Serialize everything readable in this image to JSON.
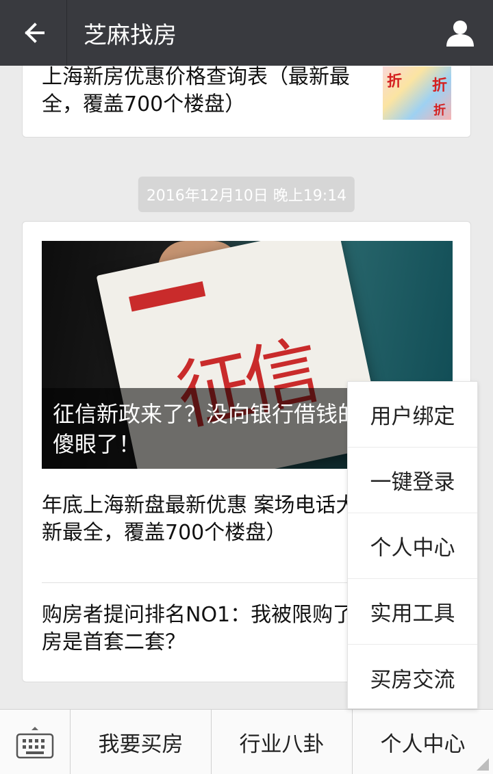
{
  "header": {
    "title": "芝麻找房"
  },
  "articles": {
    "top_card_text": "上海新房优惠价格查询表（最新最全，覆盖700个楼盘）",
    "thumb_glyph": "折",
    "timestamp": "2016年12月10日 晚上19:14",
    "hero_caption": "征信新政来了？没向银行借钱的都傻眼了！",
    "hero_calligraphy": "征信",
    "item1": "年底上海新盘最新优惠 案场电话大放送（最新最全，覆盖700个楼盘）",
    "item2": "购房者提问排名NO1：我被限购了吗？我买房是首套二套？"
  },
  "menu": {
    "items": [
      "用户绑定",
      "一键登录",
      "个人中心",
      "实用工具",
      "买房交流"
    ]
  },
  "bottom": {
    "tabs": [
      "我要买房",
      "行业八卦",
      "个人中心"
    ]
  }
}
